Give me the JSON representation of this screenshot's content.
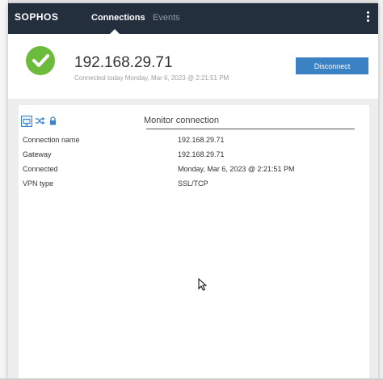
{
  "app": {
    "logo": "SOPHOS"
  },
  "tabs": [
    {
      "label": "Connections",
      "active": true
    },
    {
      "label": "Events",
      "active": false
    }
  ],
  "status": {
    "ip": "192.168.29.71",
    "connected_text": "Connected today Monday, Mar 6, 2023 @ 2:21:51 PM",
    "disconnect_label": "Disconnect",
    "accent": "#3b82c4",
    "ok_color": "#6dbb3d"
  },
  "monitor": {
    "title": "Monitor connection",
    "icons": [
      "monitor-icon",
      "shuffle-icon",
      "lock-icon"
    ],
    "rows": [
      {
        "label": "Connection name",
        "value": "192.168.29.71"
      },
      {
        "label": "Gateway",
        "value": "192.168.29.71"
      },
      {
        "label": "Connected",
        "value": "Monday, Mar 6, 2023 @ 2:21:51 PM"
      },
      {
        "label": "VPN type",
        "value": "SSL/TCP"
      }
    ]
  }
}
